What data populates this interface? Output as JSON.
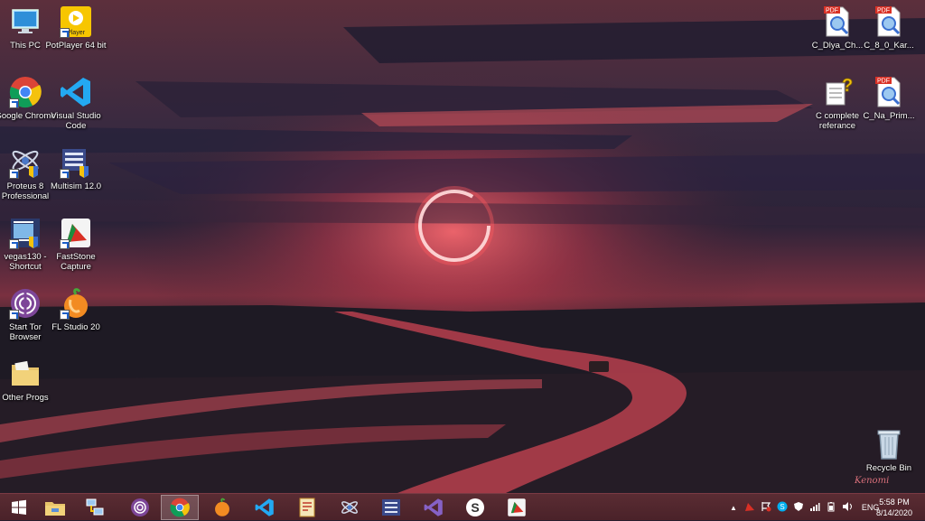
{
  "desktop": {
    "left_icons": [
      {
        "label": "This PC",
        "icon": "this-pc-icon"
      },
      {
        "label": "PotPlayer 64 bit",
        "icon": "potplayer-icon"
      },
      {
        "label": "Google Chrome",
        "icon": "chrome-icon"
      },
      {
        "label": "Visual Studio Code",
        "icon": "vscode-icon"
      },
      {
        "label": "Proteus 8 Professional",
        "icon": "proteus-icon"
      },
      {
        "label": "Multisim 12.0",
        "icon": "multisim-icon"
      },
      {
        "label": "vegas130 - Shortcut",
        "icon": "vegas-icon"
      },
      {
        "label": "FastStone Capture",
        "icon": "faststone-icon"
      },
      {
        "label": "Start Tor Browser",
        "icon": "tor-icon"
      },
      {
        "label": "FL Studio 20",
        "icon": "fl-studio-icon"
      },
      {
        "label": "Other Progs",
        "icon": "folder-icon"
      }
    ],
    "right_icons": [
      {
        "label": "C_Dlya_Ch...",
        "icon": "pdf-icon",
        "badge": "PDF"
      },
      {
        "label": "C_8_0_Kar...",
        "icon": "pdf-icon",
        "badge": "PDF"
      },
      {
        "label": "C complete referance",
        "icon": "help-file-icon"
      },
      {
        "label": "C_Na_Prim...",
        "icon": "pdf-icon",
        "badge": "PDF"
      }
    ],
    "recycle_bin": {
      "label": "Recycle Bin"
    },
    "signature": "Kenomi",
    "potplayer_text": "Player"
  },
  "taskbar": {
    "items": [
      "start-button",
      "file-explorer",
      "network-app",
      "tor-browser",
      "chrome",
      "fl-studio",
      "vscode",
      "document-app",
      "proteus",
      "multisim",
      "visual-studio",
      "sublime",
      "faststone"
    ],
    "language": "ENG",
    "time": "5:58 PM",
    "date": "8/14/2020"
  },
  "colors": {
    "taskbar": "#4a2229",
    "sky_top": "#4a2a3a",
    "sun_glow": "#e8424e",
    "road": "#c94855"
  }
}
